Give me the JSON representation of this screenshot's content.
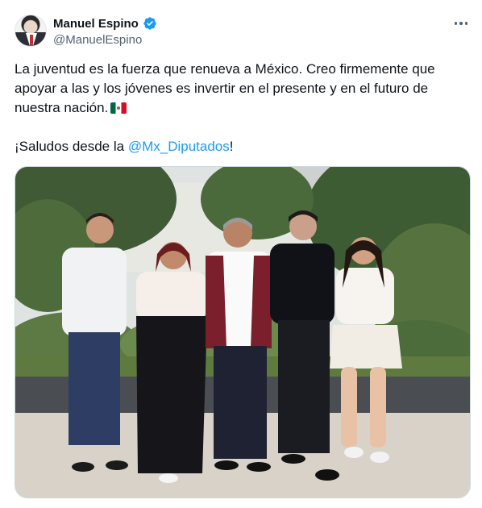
{
  "author": {
    "name": "Manuel Espino",
    "handle": "@ManuelEspino",
    "verified": true
  },
  "tweet": {
    "line1": "La juventud es la fuerza que renueva a México. Creo firmemente que apoyar a las y los jóvenes es invertir en el presente y en el futuro de nuestra nación.",
    "flag_emoji": "mexico-flag-icon",
    "greeting_prefix": "¡Saludos desde la ",
    "mention": "@Mx_Diputados",
    "greeting_suffix": "!"
  },
  "colors": {
    "link": "#1d9bf0",
    "text": "#0f1419",
    "muted": "#536471",
    "verified": "#1d9bf0"
  },
  "icons": [
    "verified-badge-icon",
    "more-options-icon"
  ]
}
